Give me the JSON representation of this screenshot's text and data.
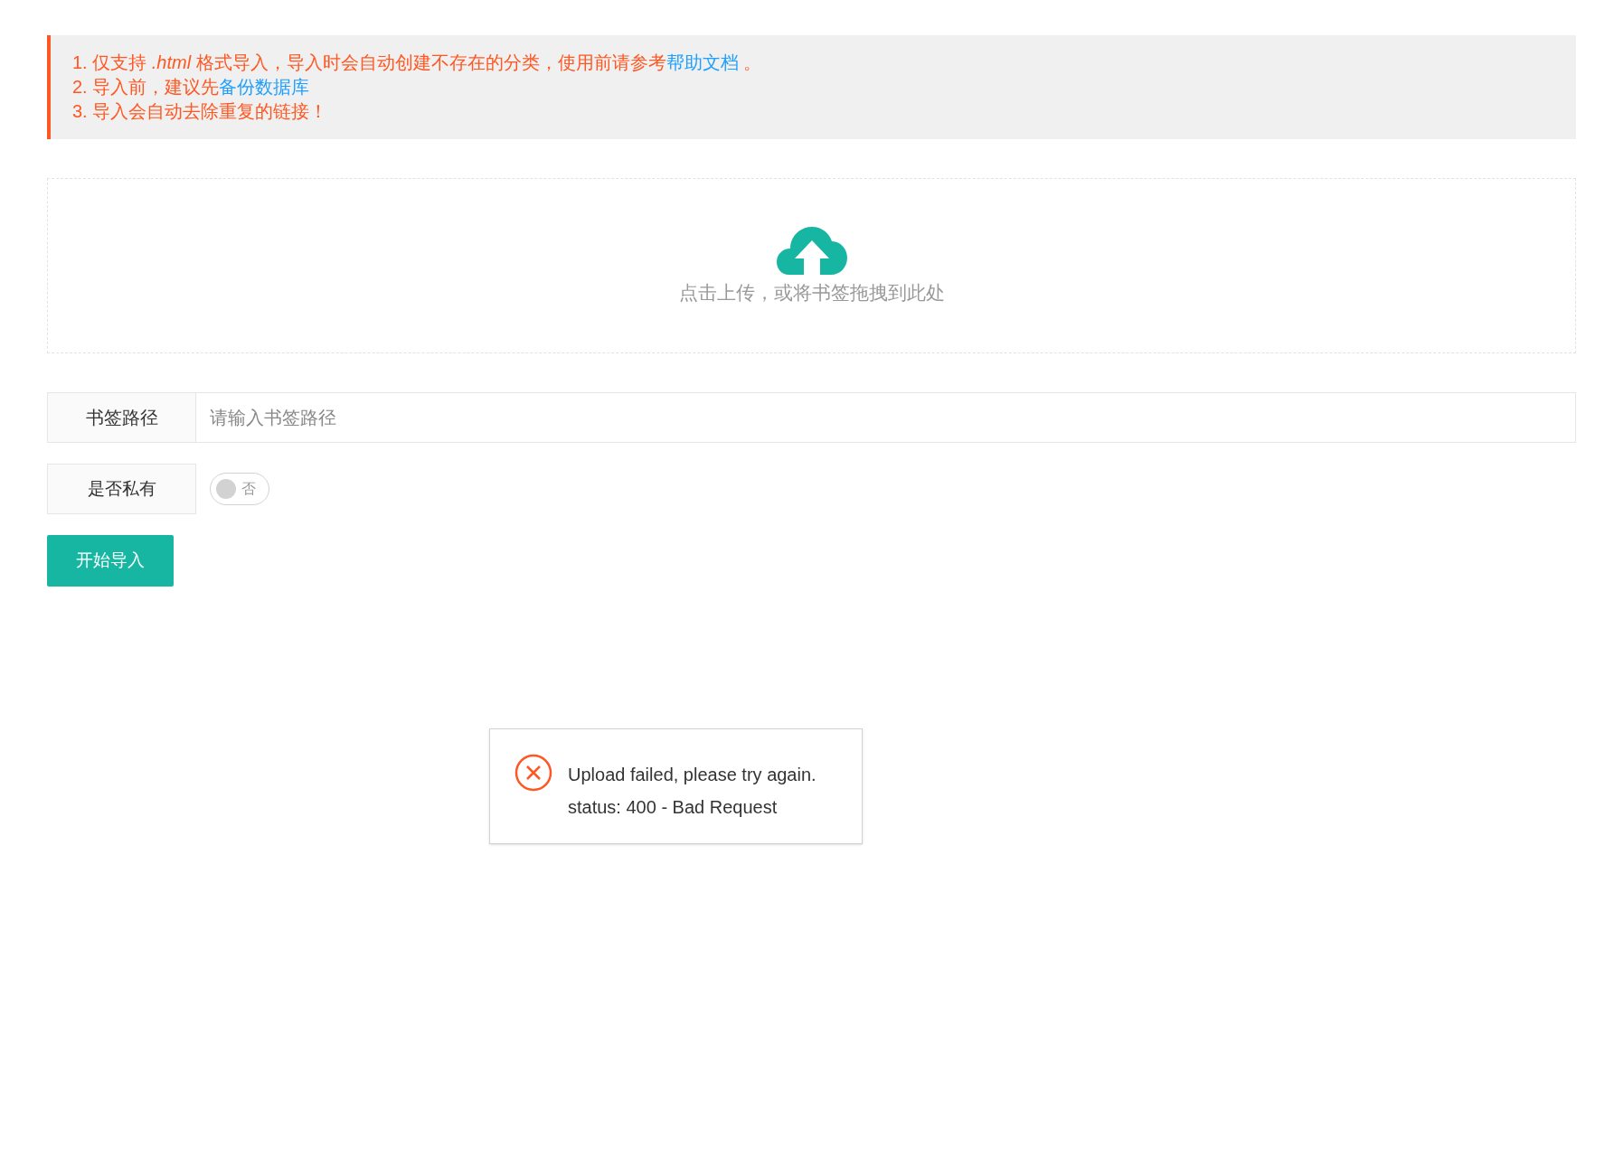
{
  "notice": {
    "lines": [
      {
        "text": "1. 仅支持 *.html* 格式导入，导入时会自动创建不存在的分类，使用前请参考",
        "link": "帮助文档",
        "after": " 。"
      },
      {
        "text": "2. 导入前，建议先",
        "link": "备份数据库"
      },
      {
        "text": "3. 导入会自动去除重复的链接！"
      }
    ]
  },
  "upload": {
    "hint": "点击上传，或将书签拖拽到此处"
  },
  "form": {
    "path": {
      "label": "书签路径",
      "placeholder": "请输入书签路径"
    },
    "private": {
      "label": "是否私有",
      "on": false,
      "text": "否"
    },
    "submit": "开始导入"
  },
  "toast": {
    "kind": "error",
    "lines": [
      "Upload failed, please try again.",
      "status: 400 - Bad Request"
    ]
  }
}
